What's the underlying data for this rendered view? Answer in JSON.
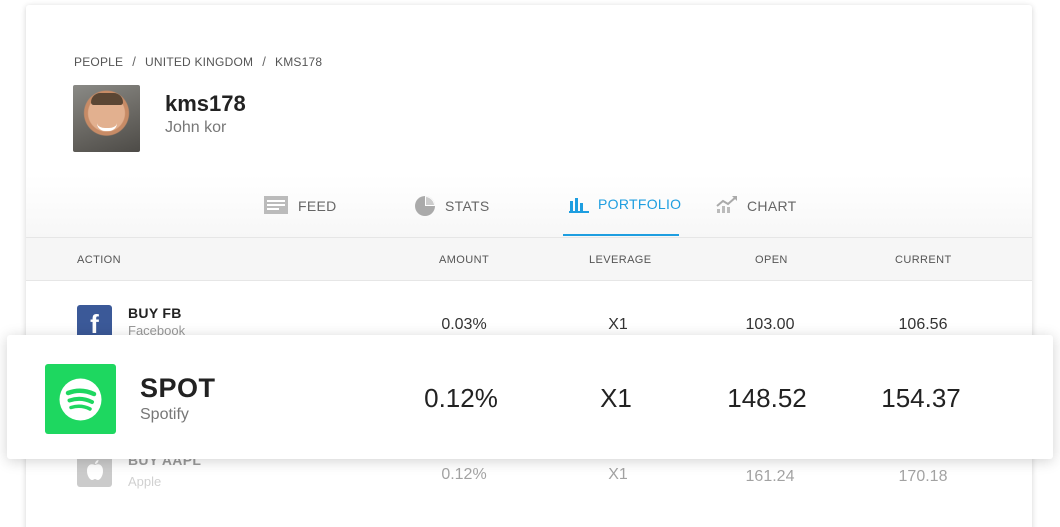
{
  "breadcrumb": {
    "items": [
      "PEOPLE",
      "UNITED KINGDOM",
      "KMS178"
    ],
    "separator": "/"
  },
  "profile": {
    "username": "kms178",
    "real_name": "John kor"
  },
  "tabs": [
    {
      "label": "FEED",
      "icon": "feed-icon"
    },
    {
      "label": "STATS",
      "icon": "pie-chart-icon"
    },
    {
      "label": "PORTFOLIO",
      "icon": "bar-chart-icon",
      "active": true
    },
    {
      "label": "CHART",
      "icon": "line-chart-icon"
    }
  ],
  "table": {
    "headers": [
      "ACTION",
      "AMOUNT",
      "LEVERAGE",
      "OPEN",
      "CURRENT"
    ],
    "rows": [
      {
        "title": "BUY FB",
        "subtitle": "Facebook",
        "amount": "0.03%",
        "leverage": "X1",
        "open": "103.00",
        "current": "106.56",
        "logo": "facebook-icon"
      },
      {
        "title": "SPOT",
        "subtitle": "Spotify",
        "amount": "0.12%",
        "leverage": "X1",
        "open": "148.52",
        "current": "154.37",
        "logo": "spotify-icon",
        "highlighted": true
      },
      {
        "title": "BUY AAPL",
        "subtitle": "Apple",
        "amount": "0.12%",
        "leverage": "X1",
        "open": "161.24",
        "current": "170.18",
        "logo": "apple-icon"
      }
    ]
  },
  "colors": {
    "accent": "#1e9ee0",
    "facebook": "#3b5998",
    "spotify": "#1ed760",
    "apple": "#8e8e8e"
  }
}
